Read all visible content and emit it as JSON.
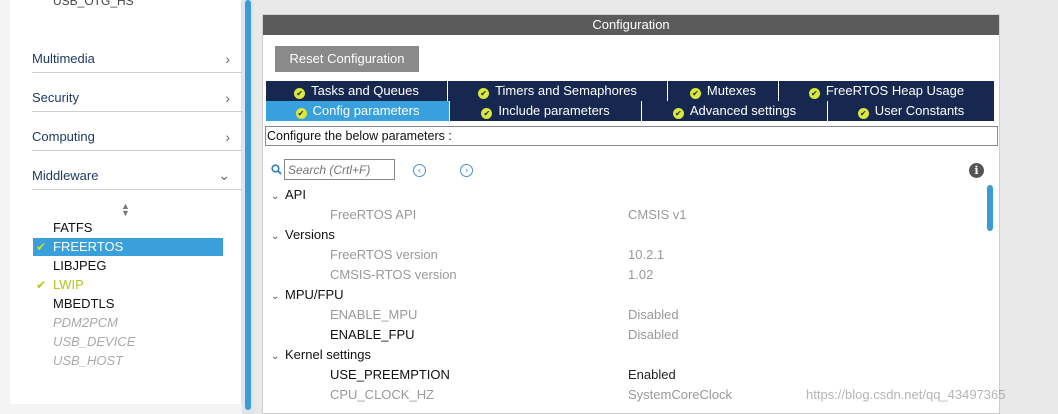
{
  "sidebar": {
    "cut_item": "USB_OTG_HS",
    "categories": [
      {
        "label": "Multimedia",
        "arrow": ">"
      },
      {
        "label": "Security",
        "arrow": ">"
      },
      {
        "label": "Computing",
        "arrow": ">"
      },
      {
        "label": "Middleware",
        "arrow": "v"
      }
    ],
    "middleware_items": [
      {
        "label": "FATFS",
        "state": "normal",
        "checked": false
      },
      {
        "label": "FREERTOS",
        "state": "selected",
        "checked": true
      },
      {
        "label": "LIBJPEG",
        "state": "normal",
        "checked": false
      },
      {
        "label": "LWIP",
        "state": "enabled",
        "checked": true
      },
      {
        "label": "MBEDTLS",
        "state": "normal",
        "checked": false
      },
      {
        "label": "PDM2PCM",
        "state": "disabled",
        "checked": false
      },
      {
        "label": "USB_DEVICE",
        "state": "disabled",
        "checked": false
      },
      {
        "label": "USB_HOST",
        "state": "disabled",
        "checked": false
      }
    ]
  },
  "config": {
    "header": "Configuration",
    "reset_label": "Reset Configuration",
    "tabs_row1": [
      "Tasks and Queues",
      "Timers and Semaphores",
      "Mutexes",
      "FreeRTOS Heap Usage"
    ],
    "tabs_row2": [
      "Config parameters",
      "Include parameters",
      "Advanced settings",
      "User Constants"
    ],
    "active_tab": "Config parameters",
    "hint": "Configure the below parameters :",
    "search_placeholder": "Search (Crtl+F)",
    "groups": [
      {
        "name": "API",
        "params": [
          {
            "name": "FreeRTOS API",
            "value": "CMSIS v1",
            "editable": false
          }
        ]
      },
      {
        "name": "Versions",
        "params": [
          {
            "name": "FreeRTOS version",
            "value": "10.2.1",
            "editable": false
          },
          {
            "name": "CMSIS-RTOS version",
            "value": "1.02",
            "editable": false
          }
        ]
      },
      {
        "name": "MPU/FPU",
        "params": [
          {
            "name": "ENABLE_MPU",
            "value": "Disabled",
            "editable": false
          },
          {
            "name": "ENABLE_FPU",
            "value": "Disabled",
            "editable": true
          }
        ]
      },
      {
        "name": "Kernel settings",
        "params": [
          {
            "name": "USE_PREEMPTION",
            "value": "Enabled",
            "editable": true
          },
          {
            "name": "CPU_CLOCK_HZ",
            "value": "SystemCoreClock",
            "editable": false
          }
        ]
      }
    ]
  },
  "watermark": "https://blog.csdn.net/qq_43497365",
  "colors": {
    "accent": "#38a0dc",
    "tab_dark": "#16284f",
    "check": "#c8e01a"
  }
}
